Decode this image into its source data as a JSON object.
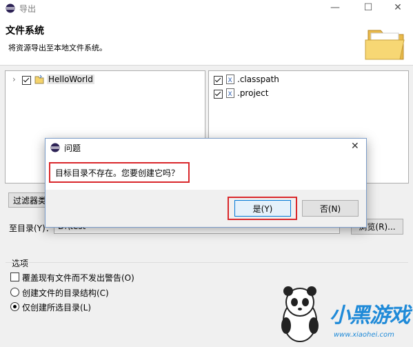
{
  "window": {
    "title": "导出"
  },
  "header": {
    "title": "文件系统",
    "subtitle": "将资源导出至本地文件系统。"
  },
  "left_tree": {
    "items": [
      {
        "label": "HelloWorld",
        "checked": true
      }
    ]
  },
  "right_list": {
    "items": [
      {
        "label": ".classpath",
        "checked": true
      },
      {
        "label": ".project",
        "checked": true
      }
    ]
  },
  "filter_button": {
    "label": "过滤器类型"
  },
  "target": {
    "label": "至目录(Y)：",
    "value": "D:\\test",
    "browse_label": "浏览(R)..."
  },
  "options": {
    "group_label": "选项",
    "overwrite": {
      "label": "覆盖现有文件而不发出警告(O)",
      "checked": false
    },
    "create_dirs": {
      "label": "创建文件的目录结构(C)",
      "selected": false
    },
    "create_selected": {
      "label": "仅创建所选目录(L)",
      "selected": true
    }
  },
  "dialog": {
    "title": "问题",
    "message": "目标目录不存在。您要创建它吗？",
    "yes_label": "是(Y)",
    "no_label": "否(N)"
  },
  "watermark": {
    "text": "小黑游戏",
    "url": "www.xiaohei.com"
  },
  "colors": {
    "highlight_red": "#d9262a",
    "accent_blue": "#0078d7",
    "watermark_blue": "#1f8ad8"
  }
}
